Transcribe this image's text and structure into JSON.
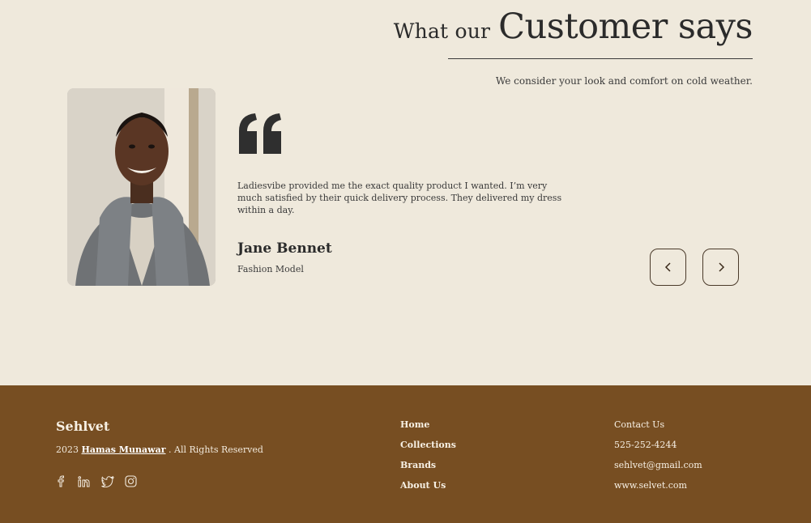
{
  "testimonial": {
    "heading_small": "What our",
    "heading_big": "Customer says",
    "subtitle": "We consider your look and comfort on cold weather.",
    "quote": "Ladiesvibe provided me the exact quality product I wanted. I’m very much satisfied by their quick delivery process. They delivered my dress within a day.",
    "name": "Jane Bennet",
    "role": "Fashion Model",
    "quote_icon": "quote-icon",
    "prev_icon": "chevron-left-icon",
    "next_icon": "chevron-right-icon"
  },
  "footer": {
    "brand": "Sehlvet",
    "copyright_year": "2023",
    "copyright_author": "Hamas Munawar",
    "copyright_suffix": ". All Rights Reserved",
    "socials": [
      "facebook-icon",
      "linkedin-icon",
      "twitter-icon",
      "instagram-icon"
    ],
    "links": [
      "Home",
      "Collections",
      "Brands",
      "About Us"
    ],
    "contact_title": "Contact Us",
    "phone": "525-252-4244",
    "email": "sehlvet@gmail.com",
    "website": "www.selvet.com"
  },
  "colors": {
    "background": "#efe9dc",
    "footer_bg": "#774e22",
    "text": "#2b2b2b"
  }
}
